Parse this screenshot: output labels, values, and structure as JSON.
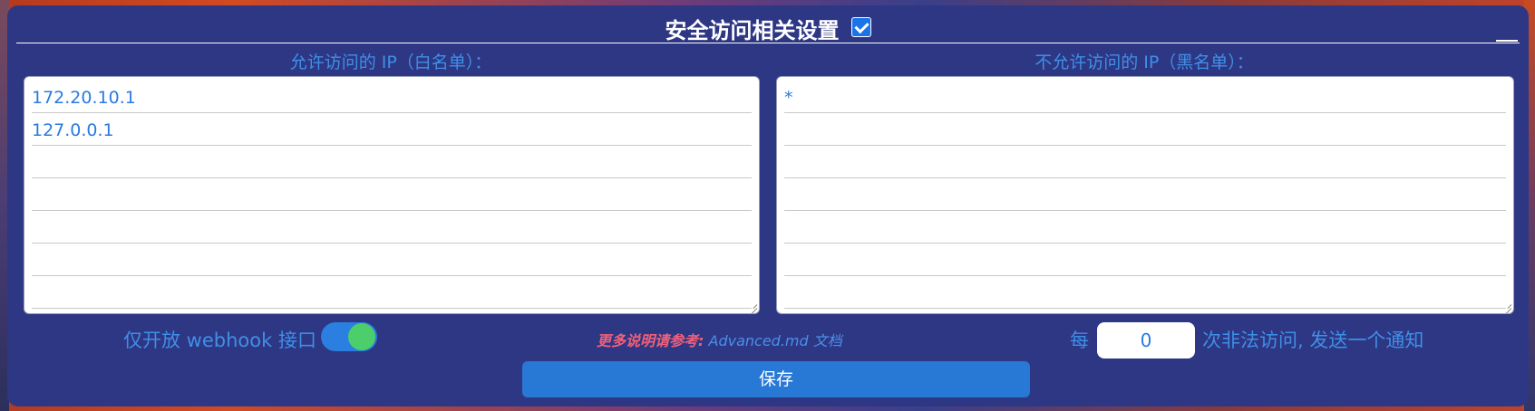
{
  "title": "安全访问相关设置",
  "title_checkbox_checked": true,
  "whitelist": {
    "label": "允许访问的 IP（白名单）：",
    "lines": [
      "172.20.10.1",
      "127.0.0.1",
      "",
      "",
      "",
      "",
      ""
    ]
  },
  "blacklist": {
    "label": "不允许访问的 IP（黑名单）：",
    "lines": [
      "*",
      "",
      "",
      "",
      "",
      "",
      ""
    ]
  },
  "webhook_only": {
    "label": "仅开放 webhook 接口",
    "enabled": true
  },
  "reference": {
    "prefix": "更多说明请参考:",
    "link": "Advanced.md 文档"
  },
  "notify": {
    "per_label": "每",
    "value": "0",
    "suffix_label": "次非法访问, 发送一个通知"
  },
  "save_label": "保存",
  "colors": {
    "panel": "#2e3784",
    "accent": "#3f8fe6",
    "save": "#2878d6",
    "toggle_on": "#4ccf6a",
    "reference_prefix": "#f0607a"
  }
}
